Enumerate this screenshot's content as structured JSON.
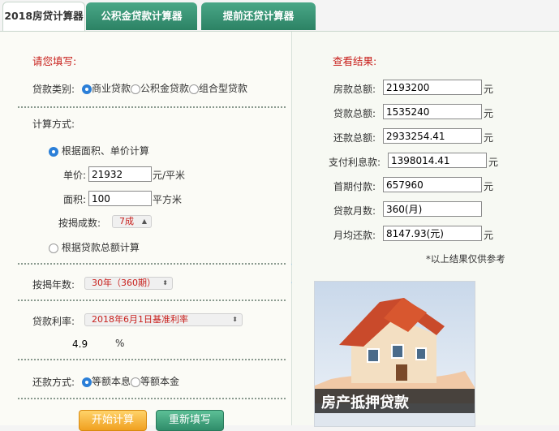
{
  "tabs": [
    {
      "label": "2018房贷计算器"
    },
    {
      "label": "公积金贷款计算器"
    },
    {
      "label": "提前还贷计算器"
    }
  ],
  "form": {
    "title": "请您填写:",
    "loan_type_label": "贷款类别:",
    "loan_types": [
      "商业贷款",
      "公积金贷款",
      "组合型贷款"
    ],
    "calc_method_label": "计算方式:",
    "method_area": "根据面积、单价计算",
    "unit_price_label": "单价:",
    "unit_price_value": "21932",
    "unit_price_unit": "元/平米",
    "area_label": "面积:",
    "area_value": "100",
    "area_unit": "平方米",
    "mortgage_ratio_label": "按揭成数:",
    "mortgage_ratio_value": "7成",
    "method_total": "根据贷款总额计算",
    "years_label": "按揭年数:",
    "years_value": "30年（360期）",
    "rate_label": "贷款利率:",
    "rate_value": "2018年6月1日基准利率",
    "rate_number": "4.9",
    "rate_unit": "%",
    "repay_label": "还款方式:",
    "repay_options": [
      "等额本息",
      "等额本金"
    ],
    "start_button": "开始计算",
    "reset_button": "重新填写"
  },
  "results": {
    "title": "查看结果:",
    "rows": [
      {
        "label": "房款总额:",
        "value": "2193200",
        "unit": "元"
      },
      {
        "label": "贷款总额:",
        "value": "1535240",
        "unit": "元"
      },
      {
        "label": "还款总额:",
        "value": "2933254.41",
        "unit": "元"
      },
      {
        "label": "支付利息款:",
        "value": "1398014.41",
        "unit": "元"
      },
      {
        "label": "首期付款:",
        "value": "657960",
        "unit": "元"
      },
      {
        "label": "贷款月数:",
        "value": "360(月)",
        "unit": ""
      },
      {
        "label": "月均还款:",
        "value": "8147.93(元)",
        "unit": "元"
      }
    ],
    "note": "*以上结果仅供参考"
  },
  "ad": {
    "caption": "房产抵押贷款"
  },
  "colors": {
    "tab_green": "#2c8264",
    "accent_red": "#c8201c",
    "radio_blue": "#2b7fd8",
    "start_btn": "#f0a020",
    "reset_btn": "#3a9a78"
  }
}
